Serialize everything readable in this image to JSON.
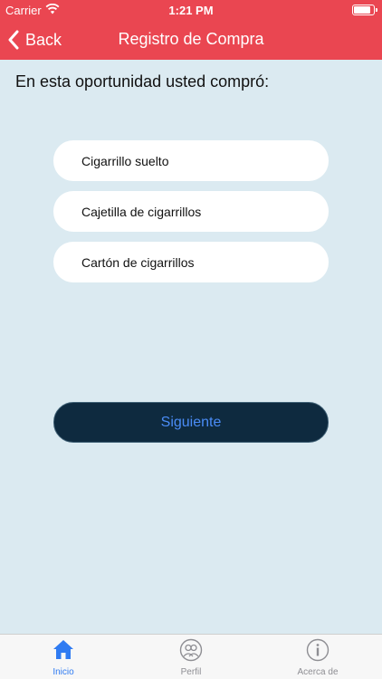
{
  "status_bar": {
    "carrier": "Carrier",
    "time": "1:21 PM",
    "battery_level": 0.85
  },
  "nav": {
    "back_label": "Back",
    "title": "Registro de Compra"
  },
  "main": {
    "prompt": "En esta oportunidad usted compró:",
    "options": [
      "Cigarrillo suelto",
      "Cajetilla de cigarrillos",
      "Cartón de cigarrillos"
    ],
    "next_label": "Siguiente"
  },
  "tabs": [
    {
      "label": "Inicio",
      "icon": "home-icon",
      "active": true
    },
    {
      "label": "Perfil",
      "icon": "profile-icon",
      "active": false
    },
    {
      "label": "Acerca de",
      "icon": "info-icon",
      "active": false
    }
  ],
  "colors": {
    "header": "#ea4651",
    "background": "#dbeaf1",
    "button": "#0e2a3f",
    "link": "#4a8cf6",
    "tab_active": "#2f7bf2",
    "tab_inactive": "#8e8e93"
  }
}
